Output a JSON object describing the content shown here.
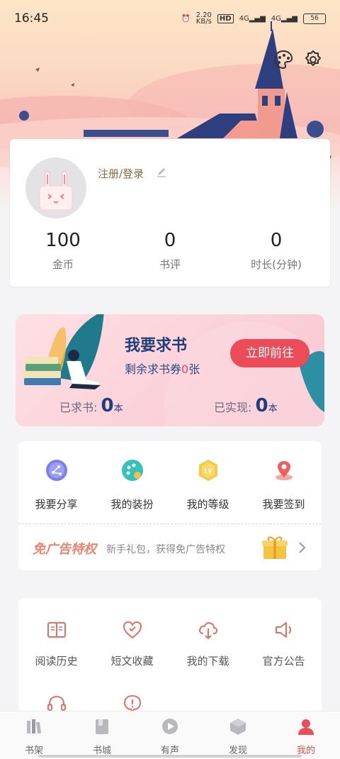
{
  "status_bar": {
    "time": "16:45",
    "speed": "2.20",
    "speed_unit": "KB/s",
    "hd": "HD",
    "net1": "4G",
    "net2": "4G",
    "battery": "56"
  },
  "profile": {
    "login_label": "注册/登录",
    "stats": [
      {
        "value": "100",
        "label": "金币"
      },
      {
        "value": "0",
        "label": "书评"
      },
      {
        "value": "0",
        "label": "时长(分钟)"
      }
    ]
  },
  "request_book": {
    "title": "我要求书",
    "remaining_prefix": "剩余求书券",
    "remaining_count": "0",
    "remaining_suffix": "张",
    "button": "立即前往",
    "requested_label": "已求书:",
    "requested_value": "0",
    "realized_label": "已实现:",
    "realized_value": "0",
    "unit": "本"
  },
  "features": {
    "items": [
      {
        "label": "我要分享",
        "icon": "share-icon"
      },
      {
        "label": "我的装扮",
        "icon": "palette-icon"
      },
      {
        "label": "我的等级",
        "icon": "level-icon"
      },
      {
        "label": "我要签到",
        "icon": "checkin-icon"
      }
    ],
    "level_badge": "LV",
    "adfree_title": "免广告特权",
    "adfree_sub": "新手礼包，获得免广告特权"
  },
  "tools": {
    "items": [
      {
        "label": "阅读历史",
        "icon": "history-icon"
      },
      {
        "label": "短文收藏",
        "icon": "heart-icon"
      },
      {
        "label": "我的下载",
        "icon": "download-icon"
      },
      {
        "label": "官方公告",
        "icon": "announcement-icon"
      }
    ],
    "row2": [
      {
        "icon": "headset-icon"
      },
      {
        "icon": "feedback-icon"
      }
    ]
  },
  "tabbar": {
    "items": [
      {
        "label": "书架",
        "icon": "bookshelf-icon"
      },
      {
        "label": "书城",
        "icon": "bookstore-icon"
      },
      {
        "label": "有声",
        "icon": "audio-icon"
      },
      {
        "label": "发现",
        "icon": "discover-icon"
      },
      {
        "label": "我的",
        "icon": "profile-icon",
        "active": true
      }
    ],
    "active_color": "#ec4c58"
  },
  "colors": {
    "accent": "#ec4c58",
    "navy": "#1e3f7a",
    "gold": "#8a6a3c"
  }
}
